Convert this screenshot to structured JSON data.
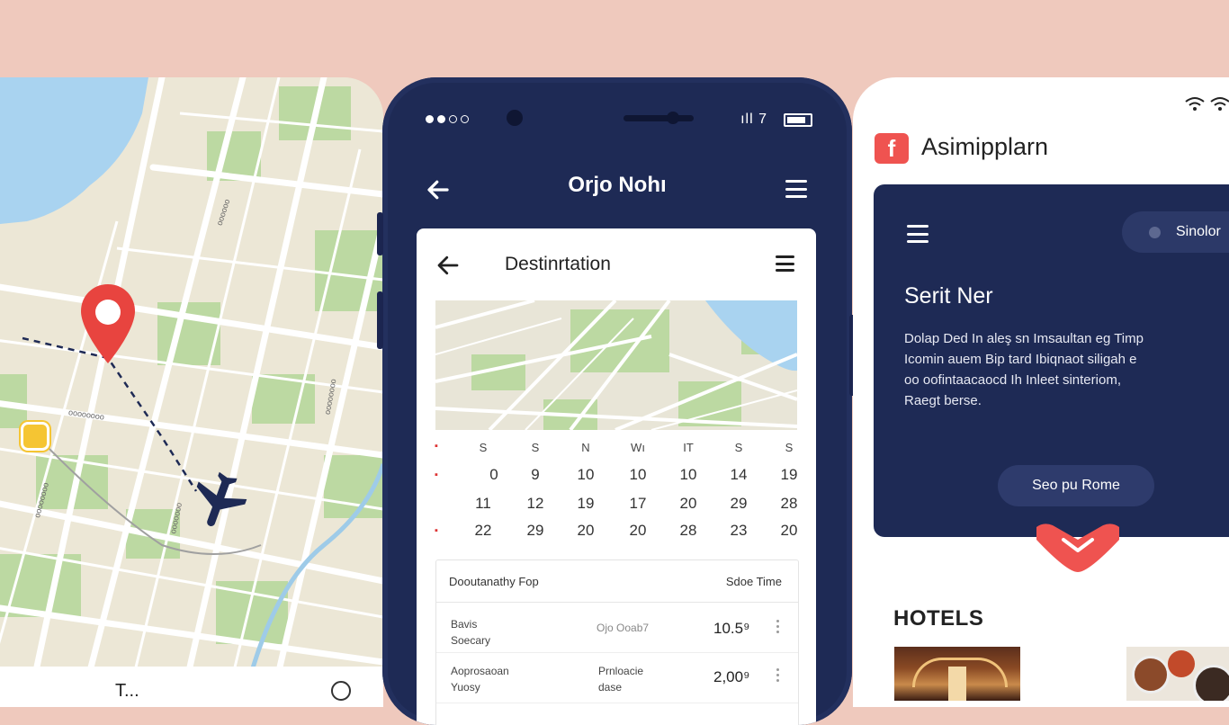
{
  "left_panel": {
    "map_labels": [
      "oooooo",
      "oooooooo",
      "oooooooo",
      "oooooooo",
      "ooooooo"
    ],
    "bottom_text": "T..."
  },
  "phone": {
    "status_time": "ıll 7",
    "title": "Orjo Nohı",
    "card": {
      "title": "Destinrtation",
      "calendar": {
        "weekdays": [
          "S",
          "S",
          "N",
          "Wı",
          "IT",
          "S",
          "S"
        ],
        "rows": [
          [
            "0",
            "9",
            "10",
            "10",
            "10",
            "14",
            "19"
          ],
          [
            "11",
            "12",
            "19",
            "17",
            "20",
            "29",
            "28"
          ],
          [
            "22",
            "29",
            "20",
            "20",
            "28",
            "23",
            "20"
          ]
        ]
      },
      "table": {
        "header_left": "Dooutanathy Fop",
        "header_right": "Sdoe Time",
        "rows": [
          {
            "name": "Bavis",
            "sub": "Soecary",
            "code": "Ojo Ooab7",
            "code_sub": "",
            "value": "10.5⁹"
          },
          {
            "name": "Aoprosaoan",
            "sub": "Yuosy",
            "code": "Prnloacie",
            "code_sub": "dase",
            "value": "2,00⁹"
          }
        ]
      }
    }
  },
  "right_panel": {
    "logo_letter": "f",
    "app_name": "Asimipplarn",
    "hero": {
      "search_label": "Sinolor",
      "title": "Serit Ner",
      "description_lines": [
        "Dolap Ded  In  aleş  sn  Imsaultan  eg  Timp",
        "Icomin  auem  Bip  tard  Ibiqnaot  siligah  e",
        "oo  oofintaacaocd  Ih  Inleet sinteriom,",
        "Raegt  berse."
      ],
      "button_label": "Seo pu Rome"
    },
    "section_title": "HOTELS"
  },
  "colors": {
    "background": "#efc9bd",
    "navy": "#1e2a55",
    "accent_red": "#ef5350",
    "map_green": "#bcd9a2",
    "map_water": "#a9d3f0"
  }
}
